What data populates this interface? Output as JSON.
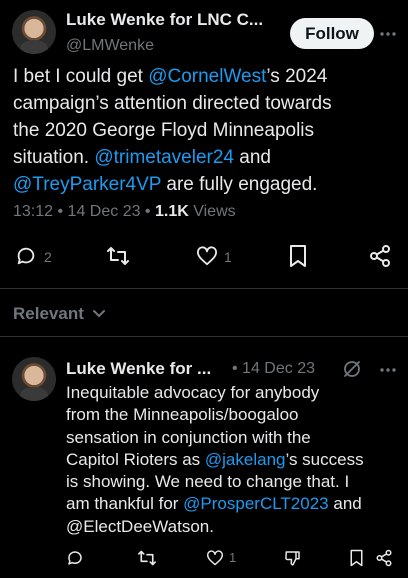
{
  "main_tweet": {
    "author_name": "Luke Wenke for LNC C...",
    "handle": "@LMWenke",
    "follow_label": "Follow",
    "body_line1": "I bet I could get ",
    "mention_cornel": "@CornelWest",
    "body_line1_rest": "’s 2024",
    "body_line2": "campaign’s attention directed towards",
    "body_line3": "the 2020 George Floyd Minneapolis",
    "body_line4_a": "situation.  ",
    "mention_trime": "@trimetaveler24",
    "body_line4_b": " and",
    "mention_trey": "@TreyParker4VP",
    "body_line5_rest": " are fully engaged.",
    "time": "13:12",
    "date": "14 Dec 23",
    "views_count": "1.1K",
    "views_label": " Views",
    "reply_count": "2",
    "like_count": "1"
  },
  "relevant": {
    "label": "Relevant"
  },
  "reply_tweet": {
    "author_name": "Luke Wenke for ...",
    "date": "14 Dec 23",
    "line1": "Inequitable advocacy for anybody",
    "line2": "from the Minneapolis/boogaloo",
    "line3": "sensation in conjunction with the",
    "line4_a": "Capitol Rioters as ",
    "mention_jake": "@jakelang",
    "line4_b": "’s success",
    "line5": "is showing.  We need to change that.  I",
    "line6_a": "am thankful for ",
    "mention_prosper": "@ProsperCLT2023",
    "line6_b": " and",
    "line7": "@ElectDeeWatson.",
    "like_count": "1"
  },
  "icons": [
    "more-icon",
    "reply-icon",
    "retweet-icon",
    "like-icon",
    "bookmark-icon",
    "share-icon",
    "chevron-down-icon",
    "grok-icon",
    "downvote-icon"
  ],
  "colors": {
    "background": "#000000",
    "text": "#e7e9ea",
    "muted": "#71767b",
    "link": "#1d9bf0",
    "divider": "#2f3336"
  }
}
